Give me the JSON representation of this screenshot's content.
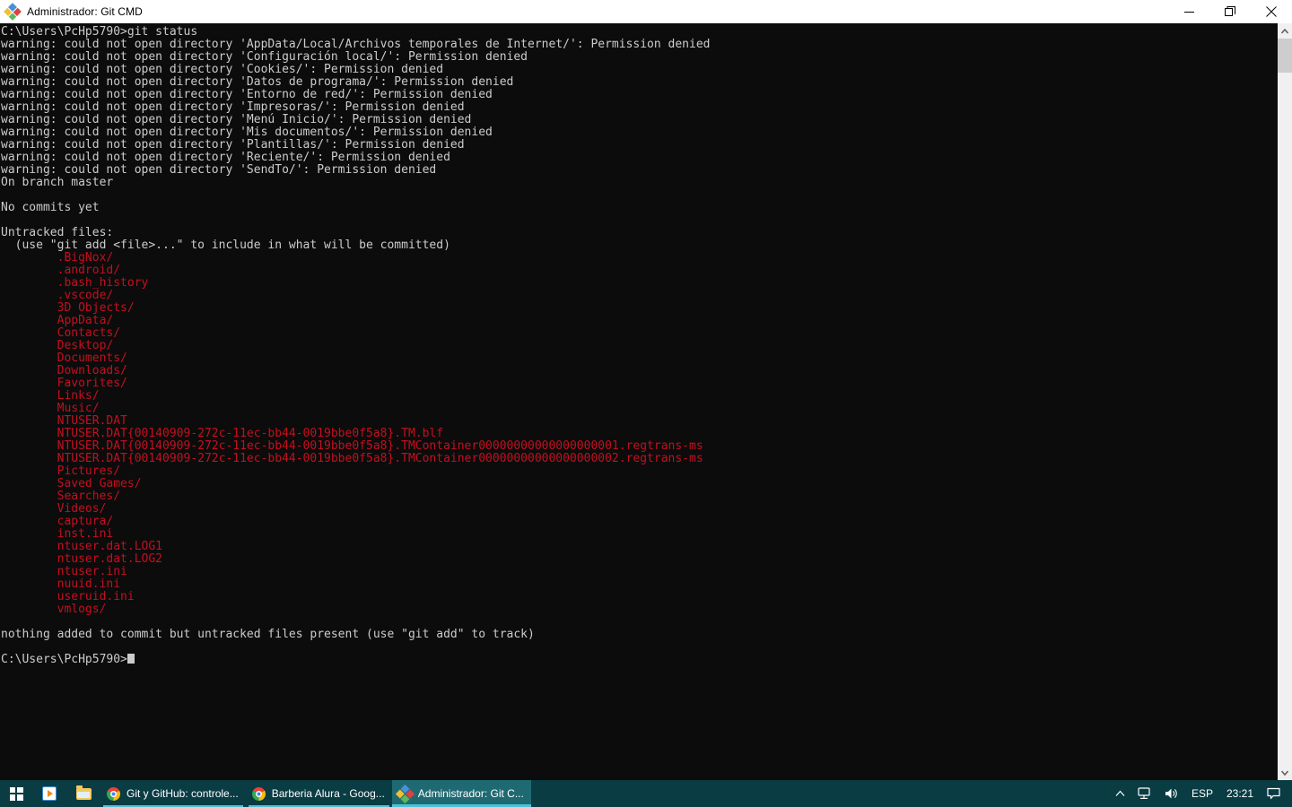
{
  "window": {
    "title": "Administrador: Git CMD",
    "icon": "git-diamond-icon",
    "controls": {
      "minimize": "Minimizar",
      "restore": "Restaurar",
      "close": "Cerrar"
    }
  },
  "colors": {
    "console_bg": "#0c0c0c",
    "console_fg": "#cccccc",
    "untracked_red": "#c50f1f",
    "titlebar_bg": "#ffffff",
    "taskbar_bg": "#0a3c44",
    "taskbar_active": "#1f6a72",
    "taskbar_accent": "#4cc2d4"
  },
  "console": {
    "lines": [
      {
        "text": "C:\\Users\\PcHp5790>git status",
        "color": "default"
      },
      {
        "text": "warning: could not open directory 'AppData/Local/Archivos temporales de Internet/': Permission denied",
        "color": "default"
      },
      {
        "text": "warning: could not open directory 'Configuración local/': Permission denied",
        "color": "default"
      },
      {
        "text": "warning: could not open directory 'Cookies/': Permission denied",
        "color": "default"
      },
      {
        "text": "warning: could not open directory 'Datos de programa/': Permission denied",
        "color": "default"
      },
      {
        "text": "warning: could not open directory 'Entorno de red/': Permission denied",
        "color": "default"
      },
      {
        "text": "warning: could not open directory 'Impresoras/': Permission denied",
        "color": "default"
      },
      {
        "text": "warning: could not open directory 'Menú Inicio/': Permission denied",
        "color": "default"
      },
      {
        "text": "warning: could not open directory 'Mis documentos/': Permission denied",
        "color": "default"
      },
      {
        "text": "warning: could not open directory 'Plantillas/': Permission denied",
        "color": "default"
      },
      {
        "text": "warning: could not open directory 'Reciente/': Permission denied",
        "color": "default"
      },
      {
        "text": "warning: could not open directory 'SendTo/': Permission denied",
        "color": "default"
      },
      {
        "text": "On branch master",
        "color": "default"
      },
      {
        "text": "",
        "color": "default"
      },
      {
        "text": "No commits yet",
        "color": "default"
      },
      {
        "text": "",
        "color": "default"
      },
      {
        "text": "Untracked files:",
        "color": "default"
      },
      {
        "text": "  (use \"git add <file>...\" to include in what will be committed)",
        "color": "default"
      },
      {
        "text": "        .BigNox/",
        "color": "red"
      },
      {
        "text": "        .android/",
        "color": "red"
      },
      {
        "text": "        .bash_history",
        "color": "red"
      },
      {
        "text": "        .vscode/",
        "color": "red"
      },
      {
        "text": "        3D Objects/",
        "color": "red"
      },
      {
        "text": "        AppData/",
        "color": "red"
      },
      {
        "text": "        Contacts/",
        "color": "red"
      },
      {
        "text": "        Desktop/",
        "color": "red"
      },
      {
        "text": "        Documents/",
        "color": "red"
      },
      {
        "text": "        Downloads/",
        "color": "red"
      },
      {
        "text": "        Favorites/",
        "color": "red"
      },
      {
        "text": "        Links/",
        "color": "red"
      },
      {
        "text": "        Music/",
        "color": "red"
      },
      {
        "text": "        NTUSER.DAT",
        "color": "red"
      },
      {
        "text": "        NTUSER.DAT{00140909-272c-11ec-bb44-0019bbe0f5a8}.TM.blf",
        "color": "red"
      },
      {
        "text": "        NTUSER.DAT{00140909-272c-11ec-bb44-0019bbe0f5a8}.TMContainer00000000000000000001.regtrans-ms",
        "color": "red"
      },
      {
        "text": "        NTUSER.DAT{00140909-272c-11ec-bb44-0019bbe0f5a8}.TMContainer00000000000000000002.regtrans-ms",
        "color": "red"
      },
      {
        "text": "        Pictures/",
        "color": "red"
      },
      {
        "text": "        Saved Games/",
        "color": "red"
      },
      {
        "text": "        Searches/",
        "color": "red"
      },
      {
        "text": "        Videos/",
        "color": "red"
      },
      {
        "text": "        captura/",
        "color": "red"
      },
      {
        "text": "        inst.ini",
        "color": "red"
      },
      {
        "text": "        ntuser.dat.LOG1",
        "color": "red"
      },
      {
        "text": "        ntuser.dat.LOG2",
        "color": "red"
      },
      {
        "text": "        ntuser.ini",
        "color": "red"
      },
      {
        "text": "        nuuid.ini",
        "color": "red"
      },
      {
        "text": "        useruid.ini",
        "color": "red"
      },
      {
        "text": "        vmlogs/",
        "color": "red"
      },
      {
        "text": "",
        "color": "default"
      },
      {
        "text": "nothing added to commit but untracked files present (use \"git add\" to track)",
        "color": "default"
      },
      {
        "text": "",
        "color": "default"
      },
      {
        "text": "C:\\Users\\PcHp5790>",
        "color": "default",
        "cursor": true
      }
    ]
  },
  "scrollbar": {
    "up_arrow": "scroll-up-icon",
    "down_arrow": "scroll-down-icon"
  },
  "taskbar": {
    "start_label": "Inicio",
    "pinned": [
      {
        "name": "media-player",
        "icon": "media-player-icon",
        "label": ""
      },
      {
        "name": "file-explorer",
        "icon": "folder-icon",
        "label": ""
      }
    ],
    "tasks": [
      {
        "name": "chrome-git-github",
        "icon": "chrome-icon",
        "label": "Git y GitHub: controle...",
        "active": false
      },
      {
        "name": "chrome-barberia-alura",
        "icon": "chrome-icon",
        "label": "Barberia Alura - Goog...",
        "active": false
      },
      {
        "name": "git-cmd",
        "icon": "git-diamond-icon",
        "label": "Administrador: Git C...",
        "active": true
      }
    ],
    "tray": {
      "show_hidden": "chevron-up-icon",
      "network": "network-icon",
      "volume": "volume-icon",
      "language": "ESP",
      "clock": "23:21",
      "notifications": "notification-icon"
    }
  }
}
